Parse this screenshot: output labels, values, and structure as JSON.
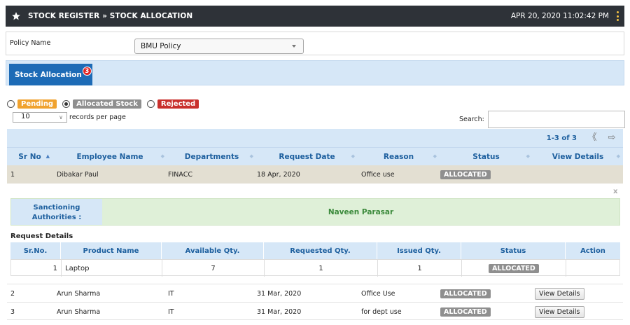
{
  "header": {
    "title": "STOCK REGISTER » STOCK ALLOCATION",
    "datetime": "APR 20, 2020  11:02:42 PM",
    "icon": "star-icon",
    "menu_icon": "kebab-icon"
  },
  "policy": {
    "label": "Policy Name",
    "selected": "BMU Policy"
  },
  "tabs": [
    {
      "label": "Stock Allocation",
      "badge": "3"
    }
  ],
  "filters": {
    "pending": "Pending",
    "allocated": "Allocated Stock",
    "rejected": "Rejected",
    "selected": "allocated"
  },
  "table_controls": {
    "per_page_value": "10",
    "per_page_label": "records per page",
    "search_label": "Search:",
    "page_info": "1-3 of 3",
    "prev_icon": "double-chevron-left-icon",
    "next_icon": "arrow-right-icon"
  },
  "table": {
    "columns": [
      "Sr No",
      "Employee Name",
      "Departments",
      "Request Date",
      "Reason",
      "Status",
      "View Details"
    ],
    "rows": [
      {
        "sr": "1",
        "employee": "Dibakar Paul",
        "dept": "FINACC",
        "date": "18 Apr, 2020",
        "reason": "Office use",
        "status": "ALLOCATED",
        "action": ""
      },
      {
        "sr": "2",
        "employee": "Arun Sharma",
        "dept": "IT",
        "date": "31 Mar, 2020",
        "reason": "Office Use",
        "status": "ALLOCATED",
        "action": "View Details"
      },
      {
        "sr": "3",
        "employee": "Arun Sharma",
        "dept": "IT",
        "date": "31 Mar, 2020",
        "reason": "for dept use",
        "status": "ALLOCATED",
        "action": "View Details"
      }
    ]
  },
  "detail": {
    "close": "x",
    "sanction_label": "Sanctioning Authorities :",
    "sanction_name": "Naveen Parasar",
    "request_title": "Request Details",
    "columns": [
      "Sr.No.",
      "Product Name",
      "Available Qty.",
      "Requested Qty.",
      "Issued Qty.",
      "Status",
      "Action"
    ],
    "rows": [
      {
        "sr": "1",
        "product": "Laptop",
        "available": "7",
        "requested": "1",
        "issued": "1",
        "status": "ALLOCATED",
        "action": ""
      }
    ]
  },
  "colors": {
    "header_bg": "#2e3238",
    "tab_active": "#1d6bb6",
    "badge": "#e02626",
    "pending": "#f0a22e",
    "allocated": "#8f8f8f",
    "rejected": "#c9302c",
    "table_header": "#d6e7f7",
    "selected_row": "#e3dfd2",
    "sanction_bg": "#dff0d8"
  }
}
